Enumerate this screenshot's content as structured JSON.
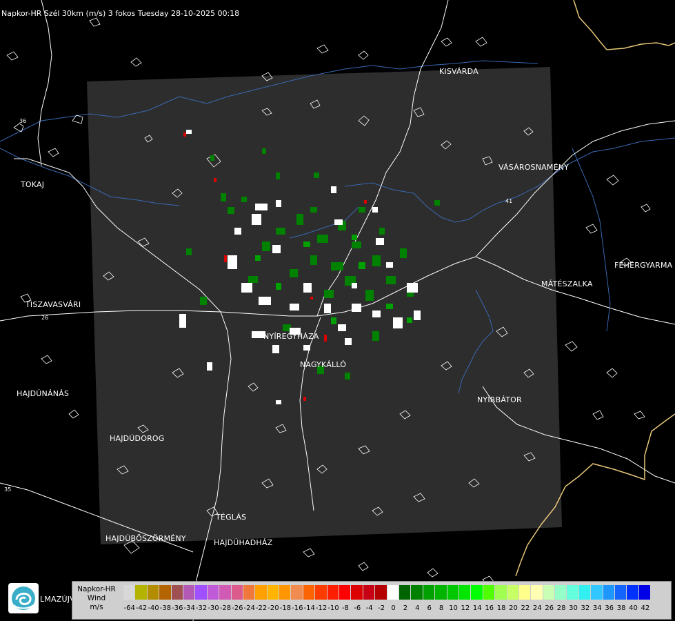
{
  "header": {
    "title": "Napkor-HR Szél 30km (m/s) 3 fokos Tuesday 28-10-2025 00:18"
  },
  "cities": [
    {
      "id": "kisvarda",
      "name": "KISVÁRDA"
    },
    {
      "id": "tokaj",
      "name": "TOKAJ"
    },
    {
      "id": "vasarosnameny",
      "name": "VÁSÁROSNAMÉNY"
    },
    {
      "id": "fehergyarmat",
      "name": "FEHÉRGYARMA"
    },
    {
      "id": "mateszalka",
      "name": "MÁTÉSZALKA"
    },
    {
      "id": "tiszavasvari",
      "name": "TISZAVASVÁRI"
    },
    {
      "id": "nyiregyhaza",
      "name": "NYÍREGYHÁZA"
    },
    {
      "id": "nagykallo",
      "name": "NAGYKÁLLÓ"
    },
    {
      "id": "hajdunanas",
      "name": "HAJDÚNÁNÁS"
    },
    {
      "id": "nyirbator",
      "name": "NYÍRBÁTOR"
    },
    {
      "id": "hajdudorog",
      "name": "HAJDÚDOROG"
    },
    {
      "id": "teglas",
      "name": "TÉGLÁS"
    },
    {
      "id": "hajduboszormeny",
      "name": "HAJDÚBÖSZÖRMÉNY"
    },
    {
      "id": "hajduhadhaz",
      "name": "HAJDÚHADHÁZ"
    },
    {
      "id": "balmazujvaros",
      "name": "LMAZÚJVÁR"
    }
  ],
  "road_numbers": [
    "36",
    "41",
    "35",
    "26"
  ],
  "legend": {
    "title": "Napkor-HR",
    "subtitle": "Wind",
    "unit": "m/s",
    "ticks": [
      "-64",
      "-42",
      "-40",
      "-38",
      "-36",
      "-34",
      "-32",
      "-30",
      "-28",
      "-26",
      "-24",
      "-22",
      "-20",
      "-18",
      "-16",
      "-14",
      "-12",
      "-10",
      "-8",
      "-6",
      "-4",
      "-2",
      "0",
      "2",
      "4",
      "6",
      "8",
      "10",
      "12",
      "14",
      "16",
      "18",
      "20",
      "22",
      "24",
      "26",
      "28",
      "30",
      "32",
      "34",
      "36",
      "38",
      "40",
      "42"
    ],
    "colors": [
      "#d8d8d8",
      "#b4b400",
      "#b48c00",
      "#b46400",
      "#a05050",
      "#b45ab4",
      "#a050ff",
      "#c05ad8",
      "#d05ab4",
      "#dc5a8c",
      "#f0783c",
      "#ffa000",
      "#ffb400",
      "#ff9600",
      "#f08c50",
      "#ff6400",
      "#ff3c00",
      "#ff1e00",
      "#ff0000",
      "#dc0000",
      "#c80014",
      "#b40000",
      "#ffffff",
      "#006400",
      "#008200",
      "#00a000",
      "#00b400",
      "#00c800",
      "#00e600",
      "#00ff00",
      "#50ff00",
      "#a0ff50",
      "#c8ff64",
      "#ffff8c",
      "#ffffb4",
      "#c8ffb4",
      "#96ffc8",
      "#64ffdc",
      "#32f0f0",
      "#32c8ff",
      "#1e96ff",
      "#1464ff",
      "#0032ff",
      "#0000e6"
    ]
  },
  "colors": {
    "background": "#000000",
    "radar_area": "#2d2d2d",
    "border": "#e8c77a",
    "river": "#3a68b4",
    "road": "#ffffff"
  }
}
